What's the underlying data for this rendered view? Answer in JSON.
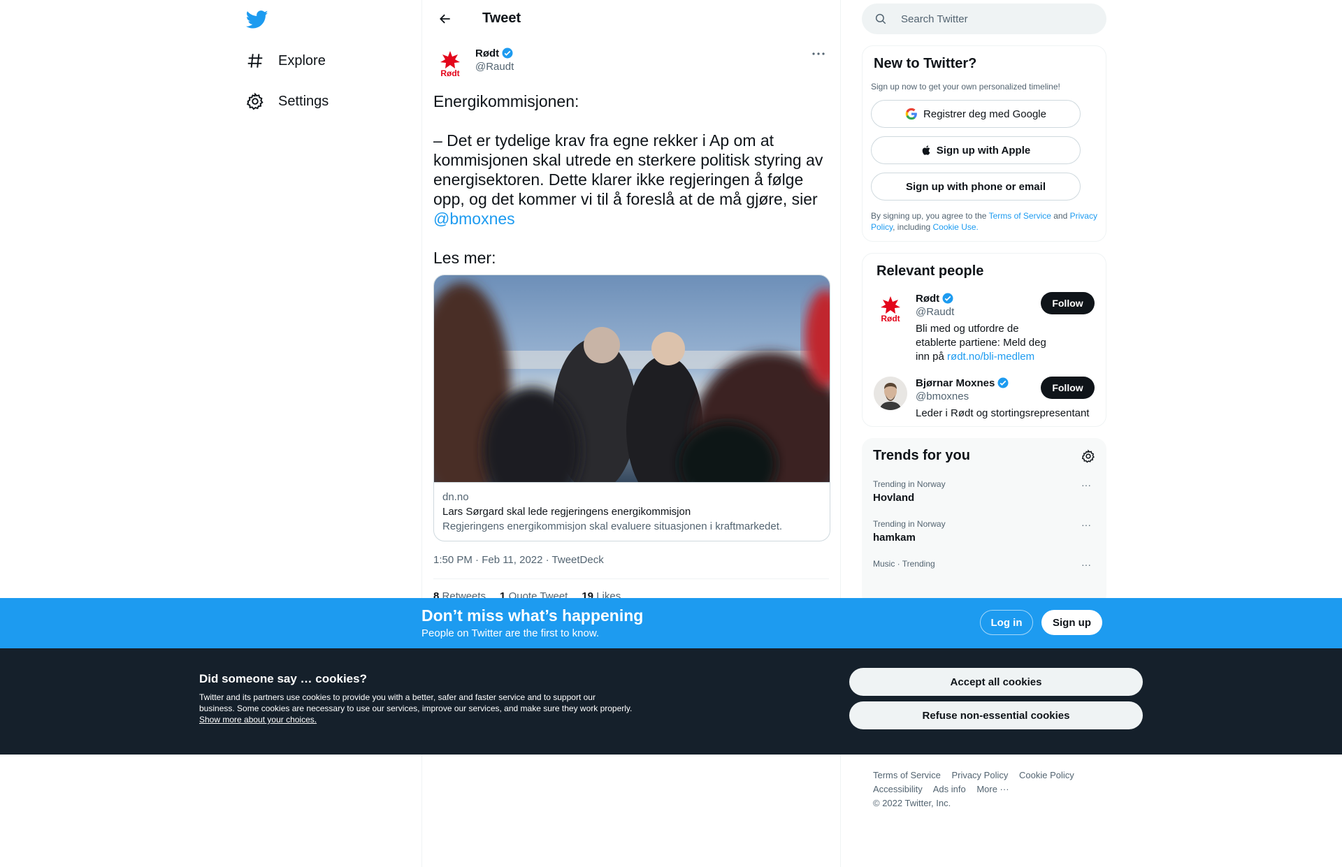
{
  "nav": {
    "explore_label": "Explore",
    "settings_label": "Settings"
  },
  "header": {
    "title": "Tweet"
  },
  "tweet": {
    "author_name": "Rødt",
    "author_handle": "@Raudt",
    "text_intro": "Energikommisjonen:\n\n– Det er tydelige krav fra egne rekker i Ap om at kommisjonen skal utrede en sterkere politisk styring av energisektoren. Dette klarer ikke regjeringen å følge opp, og det kommer vi til å foreslå at de må gjøre, sier ",
    "mention": "@bmoxnes",
    "text_outro": "\n\nLes mer:",
    "card": {
      "domain": "dn.no",
      "title": "Lars Sørgard skal lede regjeringens energikommisjon",
      "description": "Regjeringens energikommisjon skal evaluere situasjonen i kraftmarkedet."
    },
    "meta": "1:50 PM · Feb 11, 2022 · TweetDeck",
    "stats": {
      "retweets_count": "8",
      "retweets_label": "Retweets",
      "quotes_count": "1",
      "quotes_label": "Quote Tweet",
      "likes_count": "19",
      "likes_label": "Likes"
    }
  },
  "search": {
    "placeholder": "Search Twitter"
  },
  "new_to_twitter": {
    "title": "New to Twitter?",
    "subtitle": "Sign up now to get your own personalized timeline!",
    "google_label": "Registrer deg med Google",
    "apple_label": "Sign up with Apple",
    "phone_label": "Sign up with phone or email",
    "legal_prefix": "By signing up, you agree to the ",
    "terms": "Terms of Service",
    "and": " and ",
    "privacy": "Privacy Policy",
    "including": ", including ",
    "cookie_use": "Cookie Use."
  },
  "relevant_people": {
    "title": "Relevant people",
    "people": [
      {
        "name": "Rødt",
        "handle": "@Raudt",
        "bio": "Bli med og utfordre de etablerte partiene: Meld deg inn på ",
        "bio_link": "rødt.no/bli-medlem",
        "follow": "Follow"
      },
      {
        "name": "Bjørnar Moxnes",
        "handle": "@bmoxnes",
        "bio": "Leder i Rødt og stortingsrepresentant",
        "bio_link": "",
        "follow": "Follow"
      }
    ]
  },
  "trends": {
    "title": "Trends for you",
    "items": [
      {
        "context": "Trending in Norway",
        "name": "Hovland"
      },
      {
        "context": "Trending in Norway",
        "name": "hamkam"
      },
      {
        "context": "Music · Trending",
        "name": ""
      }
    ]
  },
  "footer": {
    "links": [
      "Terms of Service",
      "Privacy Policy",
      "Cookie Policy",
      "Accessibility",
      "Ads info",
      "More ···"
    ],
    "copyright": "© 2022 Twitter, Inc."
  },
  "bottom_bar": {
    "title": "Don’t miss what’s happening",
    "subtitle": "People on Twitter are the first to know.",
    "login": "Log in",
    "signup": "Sign up"
  },
  "cookie_banner": {
    "title": "Did someone say … cookies?",
    "text": "Twitter and its partners use cookies to provide you with a better, safer and faster service and to support our business. Some cookies are necessary to use our services, improve our services, and make sure they work properly. ",
    "link": "Show more about your choices.",
    "accept": "Accept all cookies",
    "refuse": "Refuse non-essential cookies"
  },
  "colors": {
    "accent": "#1d9bf0",
    "dark": "#0f1419",
    "muted": "#536471",
    "cookie_bg": "#15202b",
    "rodt_red": "#e3051b"
  }
}
